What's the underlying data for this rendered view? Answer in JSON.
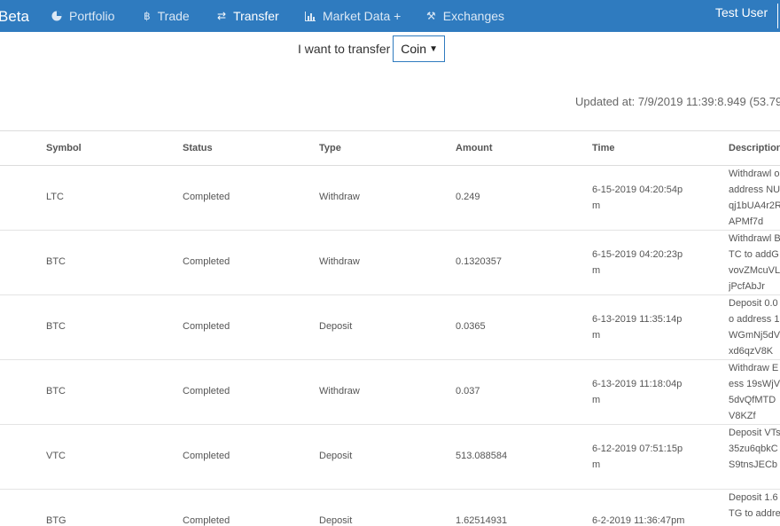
{
  "header": {
    "brand": "Beta",
    "nav": [
      {
        "label": "Portfolio",
        "icon": "pie-chart-icon"
      },
      {
        "label": "Trade",
        "icon": "bitcoin-icon"
      },
      {
        "label": "Transfer",
        "icon": "transfer-arrows-icon",
        "active": true
      },
      {
        "label": "Market Data +",
        "icon": "bar-chart-icon"
      },
      {
        "label": "Exchanges",
        "icon": "tools-icon"
      }
    ],
    "user": "Test User",
    "bar_color": "#2f7bbf"
  },
  "transfer": {
    "label": "I want to transfer",
    "selected": "Coin"
  },
  "updated": "Updated at: 7/9/2019 11:39:8.949 (53.79",
  "table": {
    "columns": [
      "Symbol",
      "Status",
      "Type",
      "Amount",
      "Time",
      "Description"
    ],
    "rows": [
      {
        "symbol": "LTC",
        "status": "Completed",
        "type": "Withdraw",
        "amount": "0.249",
        "time": "6-15-2019 04:20:54pm",
        "description": "Withdrawl o address NUqj1bUA4r2RAPMf7d"
      },
      {
        "symbol": "BTC",
        "status": "Completed",
        "type": "Withdraw",
        "amount": "0.1320357",
        "time": "6-15-2019 04:20:23pm",
        "description": "Withdrawl BTC to addGvovZMcuVLjPcfAbJr"
      },
      {
        "symbol": "BTC",
        "status": "Completed",
        "type": "Deposit",
        "amount": "0.0365",
        "time": "6-13-2019 11:35:14pm",
        "description": "Deposit 0.0o address 1WGmNj5dVxd6qzV8K"
      },
      {
        "symbol": "BTC",
        "status": "Completed",
        "type": "Withdraw",
        "amount": "0.037",
        "time": "6-13-2019 11:18:04pm",
        "description": "Withdraw Eess 19sWjV5dvQfMTDV8KZf"
      },
      {
        "symbol": "VTC",
        "status": "Completed",
        "type": "Deposit",
        "amount": "513.088584",
        "time": "6-12-2019 07:51:15pm",
        "description": "Deposit VTs 35zu6qbkCS9tnsJECb"
      },
      {
        "symbol": "BTG",
        "status": "Completed",
        "type": "Deposit",
        "amount": "1.62514931",
        "time": "6-2-2019 11:36:47pm",
        "description": "Deposit 1.6TG to addre"
      }
    ]
  }
}
